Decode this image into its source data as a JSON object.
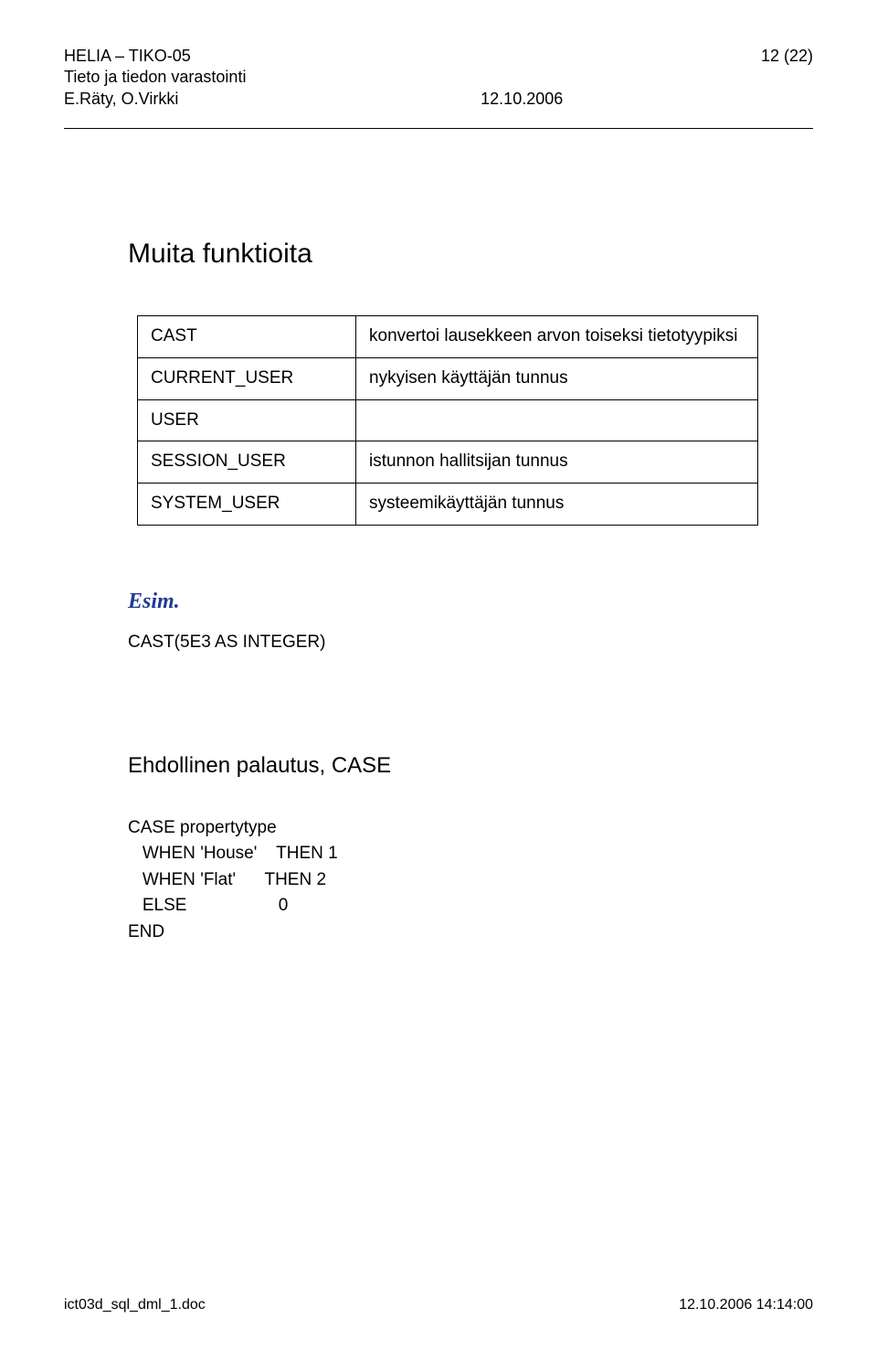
{
  "header": {
    "org_line": "HELIA – TIKO-05",
    "page_num": "12 (22)",
    "subject": "Tieto ja tiedon varastointi",
    "authors": "E.Räty, O.Virkki",
    "date": "12.10.2006"
  },
  "section_title": "Muita funktioita",
  "func_table": [
    {
      "name": "CAST",
      "desc": "konvertoi lausekkeen arvon toiseksi tietotyypiksi"
    },
    {
      "name": "CURRENT_USER",
      "desc": "nykyisen käyttäjän tunnus"
    },
    {
      "name": "USER",
      "desc": ""
    },
    {
      "name": "SESSION_USER",
      "desc": "istunnon hallitsijan tunnus"
    },
    {
      "name": "SYSTEM_USER",
      "desc": "systeemikäyttäjän tunnus"
    }
  ],
  "esim_label": "Esim.",
  "cast_example": "CAST(5E3 AS INTEGER)",
  "subsection_title": "Ehdollinen palautus, CASE",
  "case_example": {
    "line1_kw": "CASE",
    "line1_expr": "propertytype",
    "when1_kw": "WHEN",
    "when1_val": "'House'",
    "then1_kw": "THEN",
    "then1_res": "1",
    "when2_kw": "WHEN",
    "when2_val": "'Flat'",
    "then2_kw": "THEN",
    "then2_res": "2",
    "else_kw": "ELSE",
    "else_res": "0",
    "end_kw": "END"
  },
  "footer": {
    "filename": "ict03d_sql_dml_1.doc",
    "timestamp": "12.10.2006 14:14:00"
  }
}
